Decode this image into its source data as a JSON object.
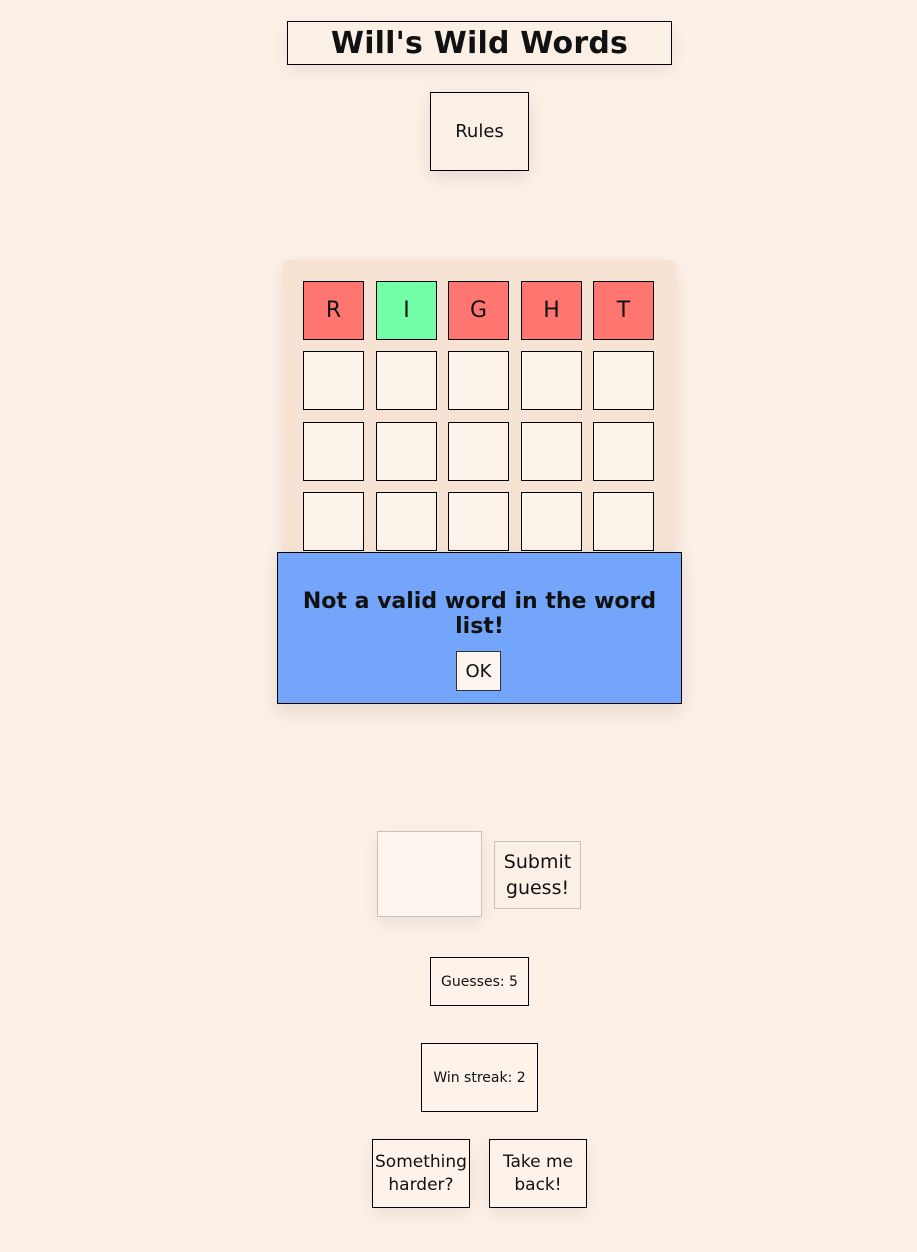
{
  "header": {
    "title": "Will's Wild Words",
    "rules_label": "Rules"
  },
  "board": {
    "rows": [
      [
        {
          "letter": "R",
          "state": "absent"
        },
        {
          "letter": "I",
          "state": "correct"
        },
        {
          "letter": "G",
          "state": "absent"
        },
        {
          "letter": "H",
          "state": "absent"
        },
        {
          "letter": "T",
          "state": "absent"
        }
      ],
      [
        {
          "letter": ""
        },
        {
          "letter": ""
        },
        {
          "letter": ""
        },
        {
          "letter": ""
        },
        {
          "letter": ""
        }
      ],
      [
        {
          "letter": ""
        },
        {
          "letter": ""
        },
        {
          "letter": ""
        },
        {
          "letter": ""
        },
        {
          "letter": ""
        }
      ],
      [
        {
          "letter": ""
        },
        {
          "letter": ""
        },
        {
          "letter": ""
        },
        {
          "letter": ""
        },
        {
          "letter": ""
        }
      ]
    ],
    "colors": {
      "absent": "#ff7671",
      "correct": "#72ffa6",
      "empty": "#fcf3eb"
    }
  },
  "modal": {
    "message": "Not a valid word in the word list!",
    "ok_label": "OK",
    "color": "#73a6fb"
  },
  "input": {
    "value": "",
    "submit_label_line1": "Submit",
    "submit_label_line2": "guess!"
  },
  "stats": {
    "guesses_text": "Guesses: 5",
    "streak_text": "Win streak: 2"
  },
  "buttons": {
    "harder_line1": "Something",
    "harder_line2": "harder?",
    "back_line1": "Take me",
    "back_line2": "back!"
  },
  "colors": {
    "background": "#fdf0e7"
  }
}
